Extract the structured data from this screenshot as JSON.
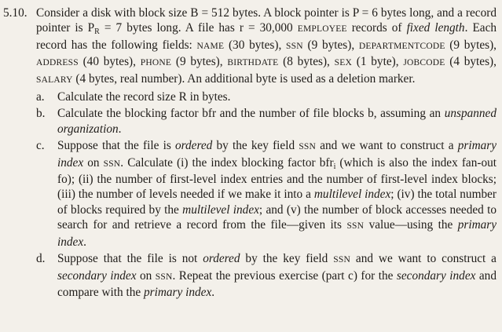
{
  "problem": {
    "number": "5.10.",
    "stem": "Consider a disk with block size B = 512 bytes. A block pointer is P = 6 bytes long, and a record pointer is P_R = 7 bytes long. A file has r = 30,000 EMPLOYEE records of fixed length. Each record has the following fields: NAME (30 bytes), SSN (9 bytes), DEPARTMENTCODE (9 bytes), ADDRESS (40 bytes), PHONE (9 bytes), BIRTHDATE (8 bytes), SEX (1 byte), JOBCODE (4 bytes), SALARY (4 bytes, real number). An additional byte is used as a deletion marker.",
    "parts": [
      {
        "label": "a.",
        "text": "Calculate the record size R in bytes."
      },
      {
        "label": "b.",
        "text": "Calculate the blocking factor bfr and the number of file blocks b, assuming an unspanned organization."
      },
      {
        "label": "c.",
        "text": "Suppose that the file is ordered by the key field SSN and we want to construct a primary index on SSN. Calculate (i) the index blocking factor bfr_i (which is also the index fan-out fo); (ii) the number of first-level index entries and the number of first-level index blocks; (iii) the number of levels needed if we make it into a multilevel index; (iv) the total number of blocks required by the multilevel index; and (v) the number of block accesses needed to search for and retrieve a record from the file—given its SSN value—using the primary index."
      },
      {
        "label": "d.",
        "text": "Suppose that the file is not ordered by the key field SSN and we want to construct a secondary index on SSN. Repeat the previous exercise (part c) for the secondary index and compare with the primary index."
      }
    ]
  }
}
